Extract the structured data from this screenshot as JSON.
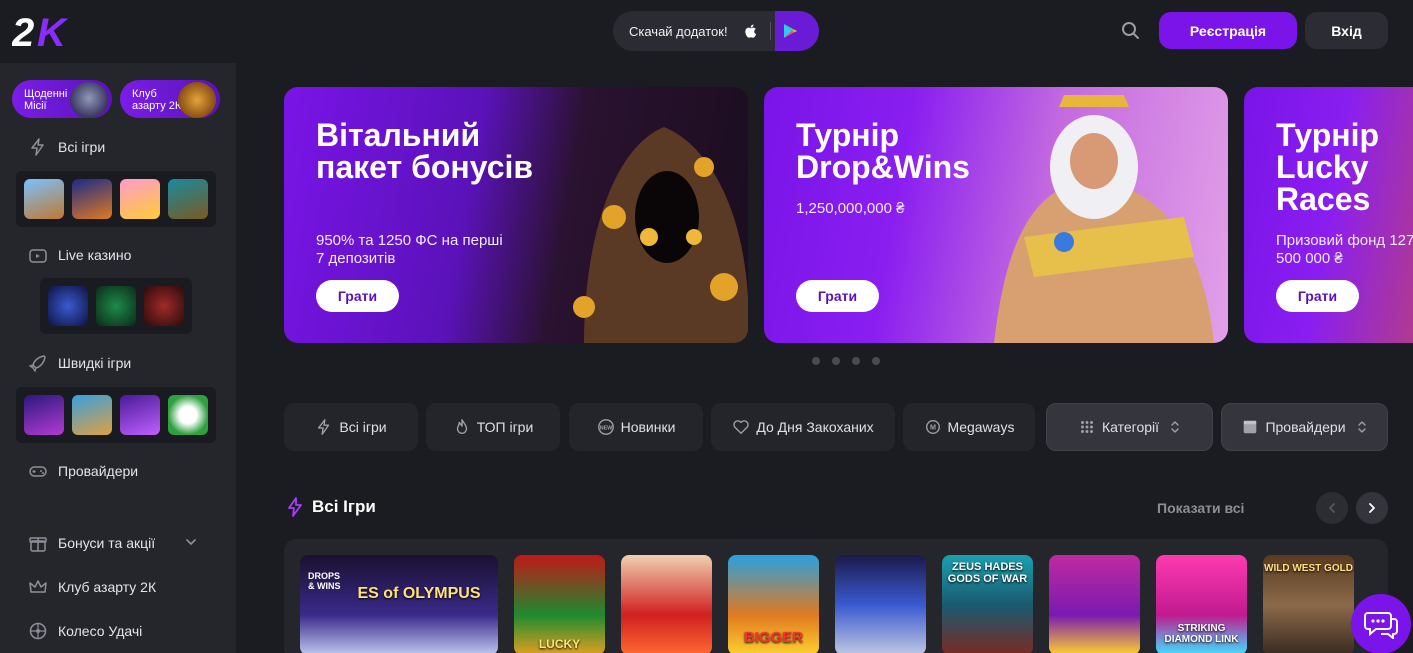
{
  "header": {
    "logo_text": "2K",
    "app_download_label": "Скачай додаток!",
    "register_label": "Реєстрація",
    "login_label": "Вхід"
  },
  "sidebar": {
    "promo_chips": [
      {
        "label": "Щоденні Місії"
      },
      {
        "label": "Клуб азарту 2К"
      }
    ],
    "items": [
      {
        "label": "Всі ігри",
        "icon": "lightning-icon"
      },
      {
        "label": "Live казино",
        "icon": "tv-icon"
      },
      {
        "label": "Швидкі ігри",
        "icon": "rocket-icon"
      },
      {
        "label": "Провайдери",
        "icon": "gamepad-icon"
      },
      {
        "label": "Бонуси та акції",
        "icon": "gift-icon"
      },
      {
        "label": "Клуб азарту 2К",
        "icon": "crown-icon"
      },
      {
        "label": "Колесо Удачі",
        "icon": "wheel-icon"
      }
    ]
  },
  "banners": [
    {
      "title": "Вітальний пакет бонусів",
      "subtitle": "950% та 1250 ФС на перші 7 депозитів",
      "button": "Грати"
    },
    {
      "title": "Турнір Drop&Wins",
      "subtitle": "1,250,000,000 ₴",
      "button": "Грати"
    },
    {
      "title": "Турнір Lucky Races",
      "subtitle": "Призовий фонд 127 500 000 ₴",
      "button": "Грати"
    }
  ],
  "filters": [
    {
      "label": "Всі ігри",
      "icon": "lightning-icon"
    },
    {
      "label": "ТОП ігри",
      "icon": "fire-icon"
    },
    {
      "label": "Новинки",
      "icon": "new-badge-icon"
    },
    {
      "label": "До Дня Закоханих",
      "icon": "heart-icon"
    },
    {
      "label": "Megaways",
      "icon": "megaways-icon"
    },
    {
      "label": "Категорії",
      "icon": "grid-icon"
    },
    {
      "label": "Провайдери",
      "icon": "box-icon"
    }
  ],
  "section": {
    "title": "Всі Ігри",
    "show_all": "Показати всі"
  },
  "games": [
    {
      "label": "ES of OLYMPUS",
      "tag": "DROPS & WINS"
    },
    {
      "label": "LUCKY"
    },
    {
      "label": ""
    },
    {
      "label": "BIGGER"
    },
    {
      "label": ""
    },
    {
      "label": "ZEUS HADES GODS OF WAR"
    },
    {
      "label": ""
    },
    {
      "label": "STRIKING DIAMOND LINK"
    },
    {
      "label": "WILD WEST GOLD"
    }
  ],
  "colors": {
    "accent": "#7a14e8",
    "background": "#1b1c21",
    "sidebar": "#25262c"
  }
}
